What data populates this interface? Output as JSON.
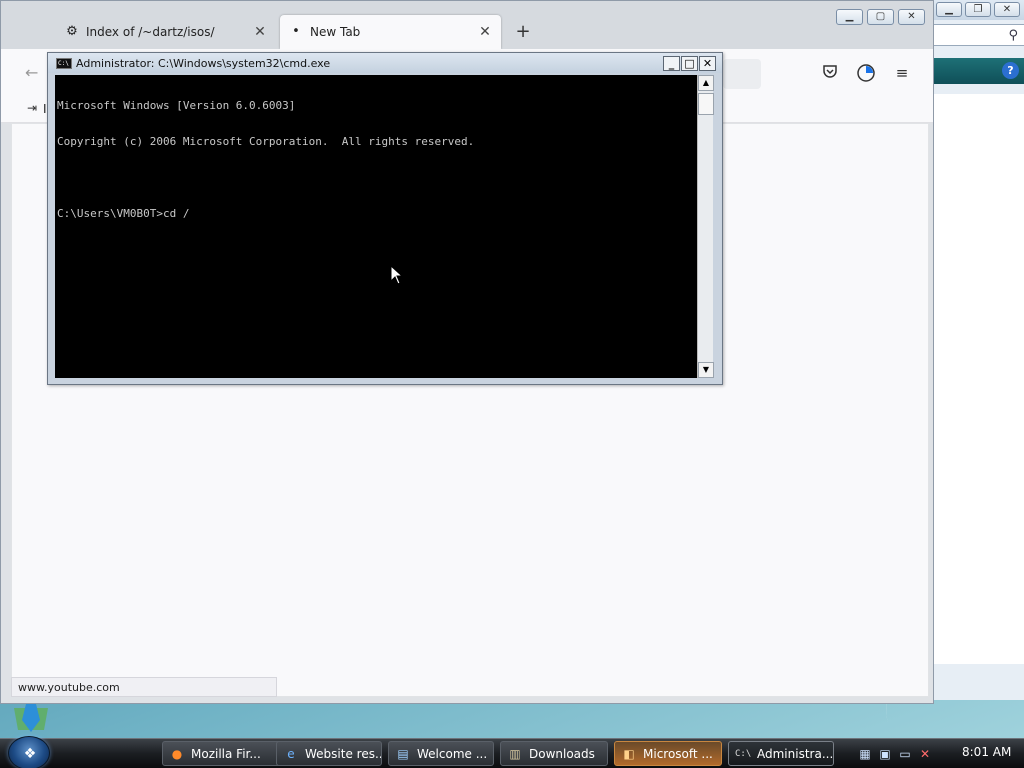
{
  "firefox": {
    "tabs": [
      {
        "label": "Index of /~dartz/isos/",
        "icon": "page-icon"
      },
      {
        "label": "New Tab",
        "icon": "dot-icon"
      }
    ],
    "new_tab_glyph": "+",
    "close_glyph": "✕",
    "bookmark_label": "I",
    "status_url": "www.youtube.com"
  },
  "cmd": {
    "title": "Administrator: C:\\Windows\\system32\\cmd.exe",
    "lines": [
      "Microsoft Windows [Version 6.0.6003]",
      "Copyright (c) 2006 Microsoft Corporation.  All rights reserved.",
      "",
      "C:\\Users\\VM0B0T>cd /"
    ]
  },
  "taskbar": {
    "buttons": [
      {
        "label": "Mozilla Fir...",
        "icon": "firefox-icon"
      },
      {
        "label": "Website res...",
        "icon": "ie-icon"
      },
      {
        "label": "Welcome ...",
        "icon": "document-icon"
      },
      {
        "label": "Downloads",
        "icon": "folder-icon"
      },
      {
        "label": "Microsoft ...",
        "icon": "app-icon"
      },
      {
        "label": "Administra...",
        "icon": "cmd-icon"
      }
    ],
    "clock": "8:01 AM"
  },
  "colors": {
    "cmd_background": "#000000",
    "cmd_text": "#c8c8c8",
    "taskbar": "#1b1e22"
  }
}
